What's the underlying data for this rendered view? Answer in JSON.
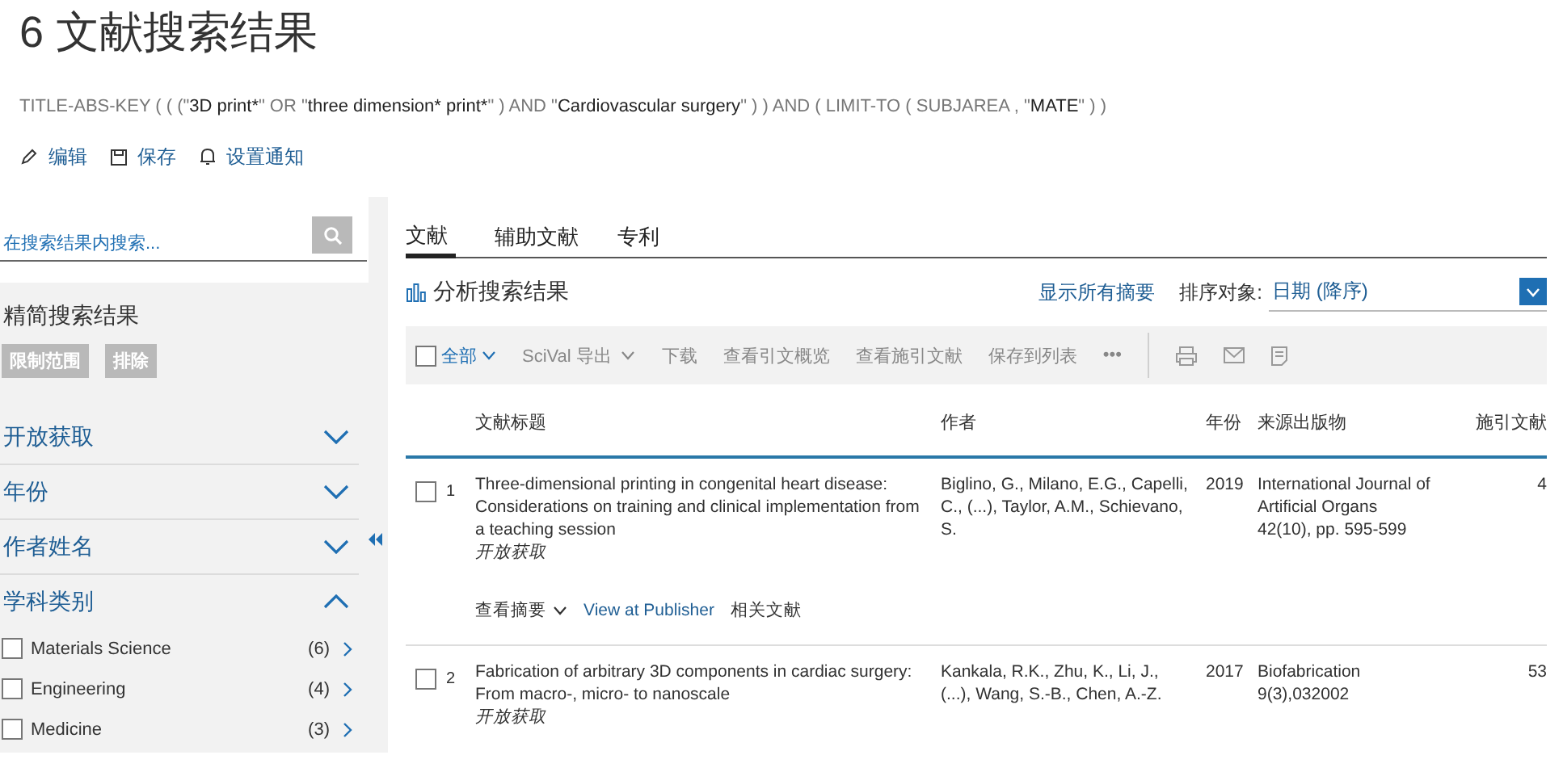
{
  "title": "6 文献搜索结果",
  "query": [
    {
      "kind": "operator",
      "text": "TITLE-ABS-KEY ( ( (\""
    },
    {
      "kind": "term",
      "text": "3D print*"
    },
    {
      "kind": "operator",
      "text": "\"  OR  \""
    },
    {
      "kind": "term",
      "text": "three dimension* print*"
    },
    {
      "kind": "operator",
      "text": "\" )  AND  \""
    },
    {
      "kind": "term",
      "text": "Cardiovascular surgery"
    },
    {
      "kind": "operator",
      "text": "\" ) )  AND  ( LIMIT-TO ( SUBJAREA ,  \""
    },
    {
      "kind": "term",
      "text": "MATE"
    },
    {
      "kind": "operator",
      "text": "\" ) )"
    }
  ],
  "actions": [
    {
      "kind": "edit",
      "label": "编辑"
    },
    {
      "kind": "save",
      "label": "保存"
    },
    {
      "kind": "alert",
      "label": "设置通知"
    }
  ],
  "sidebar": {
    "search": {
      "placeholder": "在搜索结果内搜索..."
    },
    "heading": "精简搜索结果",
    "buttons": [
      "限制范围",
      "排除"
    ],
    "facets": [
      {
        "label": "开放获取",
        "expanded": false
      },
      {
        "label": "年份",
        "expanded": false
      },
      {
        "label": "作者姓名",
        "expanded": false
      },
      {
        "label": "学科类别",
        "expanded": true,
        "items": [
          {
            "label": "Materials Science",
            "count": "(6)",
            "checked": false
          },
          {
            "label": "Engineering",
            "count": "(4)",
            "checked": false
          },
          {
            "label": "Medicine",
            "count": "(3)",
            "checked": false
          }
        ]
      }
    ]
  },
  "tabs": [
    {
      "label": "文献",
      "selected": true
    },
    {
      "label": "辅助文献",
      "selected": false
    },
    {
      "label": "专利",
      "selected": false
    }
  ],
  "analyze": "分析搜索结果",
  "show_abstracts": "显示所有摘要",
  "sort": {
    "label": "排序对象:",
    "value": "日期 (降序)"
  },
  "toolbar": {
    "select_all": "全部",
    "select_all_checked": false,
    "items": [
      "SciVal 导出",
      "下载",
      "查看引文概览",
      "查看施引文献",
      "保存到列表",
      "•••"
    ]
  },
  "table": {
    "columns": [
      "文献标题",
      "作者",
      "年份",
      "来源出版物",
      "施引文献"
    ],
    "rows": [
      {
        "number": "1",
        "checked": false,
        "title": "Three-dimensional printing in congenital heart disease: Considerations on training and clinical implementation from a teaching session",
        "access": "开放获取",
        "authors": "Biglino, G., Milano, E.G., Capelli, C., (...), Taylor, A.M., Schievano, S.",
        "year": "2019",
        "source": [
          "International Journal of Artificial Organs",
          "42(10), pp. 595-599"
        ],
        "cited": "4",
        "links": [
          "查看摘要",
          "View at Publisher",
          "相关文献"
        ]
      },
      {
        "number": "2",
        "checked": false,
        "title": "Fabrication of arbitrary 3D components in cardiac surgery: From macro-, micro- to nanoscale",
        "access": "开放获取",
        "authors": "Kankala, R.K., Zhu, K., Li, J., (...), Wang, S.-B., Chen, A.-Z.",
        "year": "2017",
        "source": [
          "Biofabrication",
          "9(3),032002"
        ],
        "cited": "53"
      }
    ]
  }
}
